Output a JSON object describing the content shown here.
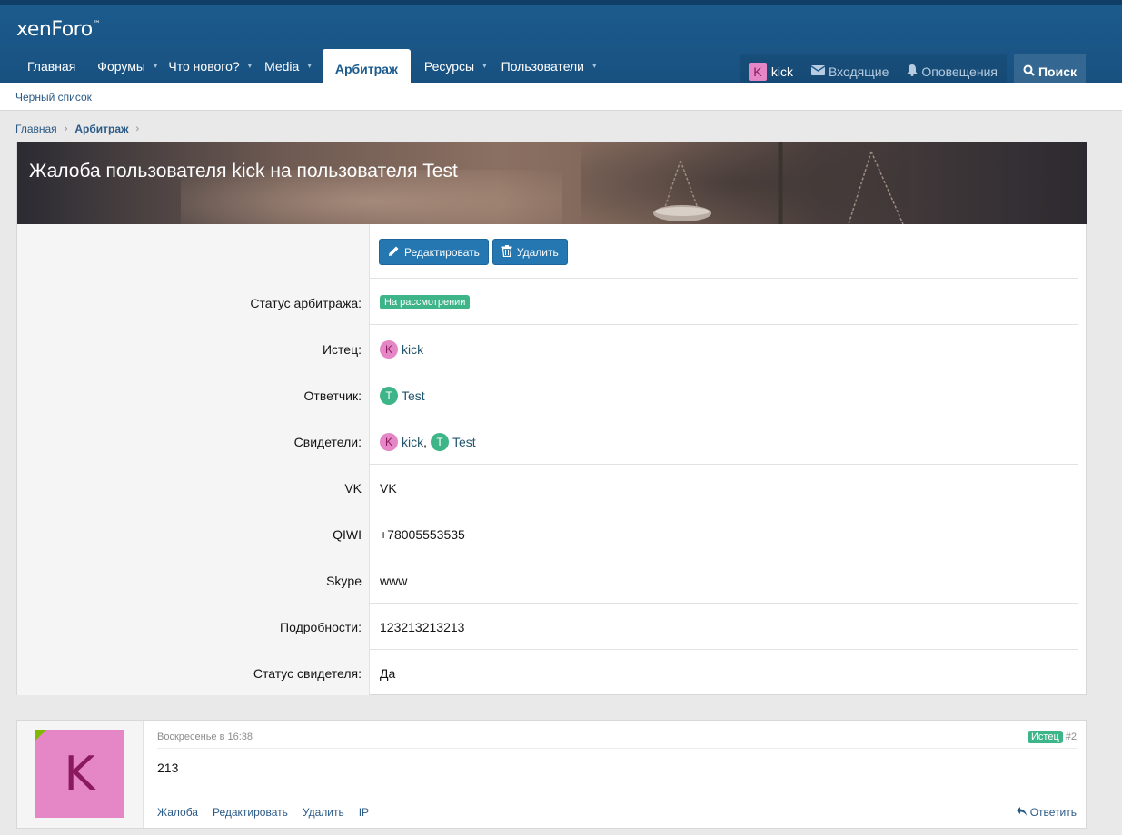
{
  "header": {
    "logo_main": "xenForo",
    "logo_tm": "™",
    "nav": [
      {
        "label": "Главная",
        "caret": false
      },
      {
        "label": "Форумы",
        "caret": true
      },
      {
        "label": "Что нового?",
        "caret": true
      },
      {
        "label": "Media",
        "caret": true
      },
      {
        "label": "Арбитраж",
        "caret": false,
        "active": true
      },
      {
        "label": "Ресурсы",
        "caret": true
      },
      {
        "label": "Пользователи",
        "caret": true
      }
    ],
    "user": {
      "avatar_letter": "K",
      "name": "kick"
    },
    "inbox_label": "Входящие",
    "alerts_label": "Оповещения",
    "search_label": "Поиск",
    "caret_glyph": "▾"
  },
  "subnav": {
    "link": "Черный список"
  },
  "breadcrumb": {
    "home": "Главная",
    "current": "Арбитраж",
    "sep": "›"
  },
  "page": {
    "title": "Жалоба пользователя kick на пользователя Test"
  },
  "actions": {
    "edit_label": "Редактировать",
    "delete_label": "Удалить"
  },
  "fields": {
    "status_label": "Статус арбитража:",
    "status_value": "На рассмотрении",
    "plaintiff_label": "Истец:",
    "plaintiff": {
      "letter": "K",
      "name": "kick"
    },
    "defendant_label": "Ответчик:",
    "defendant": {
      "letter": "T",
      "name": "Test"
    },
    "witnesses_label": "Свидетели:",
    "witnesses": [
      {
        "letter": "K",
        "name": "kick",
        "suffix": ","
      },
      {
        "letter": "T",
        "name": "Test",
        "suffix": ""
      }
    ],
    "vk_label": "VK",
    "vk_value": "VK",
    "qiwi_label": "QIWI",
    "qiwi_value": "+78005553535",
    "skype_label": "Skype",
    "skype_value": "www",
    "details_label": "Подробности:",
    "details_value": "123213213213",
    "witness_status_label": "Статус свидетеля:",
    "witness_status_value": "Да"
  },
  "post": {
    "avatar_letter": "K",
    "date": "Воскресенье в 16:38",
    "role_badge": "Истец",
    "number": "#2",
    "body": "213",
    "actions": [
      "Жалоба",
      "Редактировать",
      "Удалить",
      "IP"
    ],
    "reply_label": "Ответить"
  },
  "colors": {
    "accent": "#2577b1",
    "header": "#1c5b8d",
    "badge": "#3eb489",
    "avatar_k": "#e587c7"
  }
}
